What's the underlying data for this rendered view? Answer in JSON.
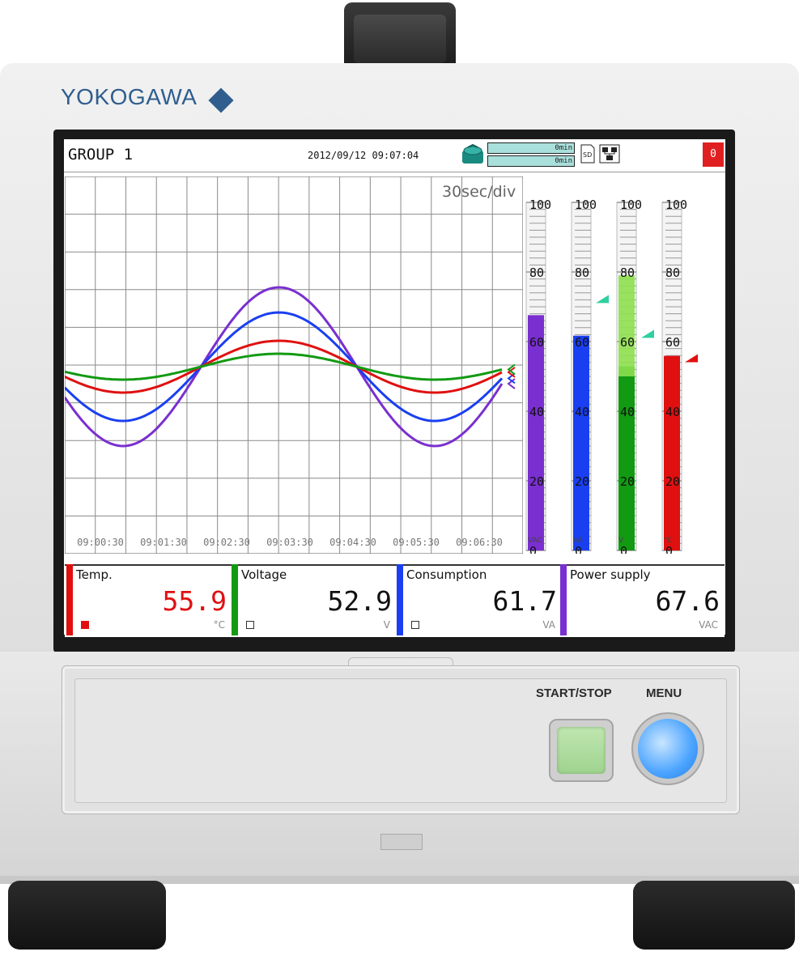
{
  "device": {
    "brand": "YOKOGAWA",
    "buttons": {
      "start_stop_label": "START/STOP",
      "menu_label": "MENU"
    }
  },
  "header": {
    "group_title": "GROUP 1",
    "datetime": "2012/09/12 09:07:04",
    "memory_bar_1": "0min",
    "memory_bar_2": "0min",
    "alarm_indicator": "0"
  },
  "trend": {
    "timebase": "30sec/div",
    "time_labels": [
      "09:00:30",
      "09:01:30",
      "09:02:30",
      "09:03:30",
      "09:04:30",
      "09:05:30",
      "09:06:30"
    ]
  },
  "bargraphs": {
    "scale_labels": [
      "100",
      "80",
      "60",
      "40",
      "20",
      "0"
    ],
    "unit_labels": [
      "VAC",
      "VA",
      "V",
      "°C"
    ]
  },
  "channels": [
    {
      "name": "Temp.",
      "value": "55.9",
      "unit": "°C",
      "color": "#e01010",
      "value_color": "#e01010"
    },
    {
      "name": "Voltage",
      "value": "52.9",
      "unit": "V",
      "color": "#129a12",
      "value_color": "#111111"
    },
    {
      "name": "Consumption",
      "value": "61.7",
      "unit": "VA",
      "color": "#1a3ff0",
      "value_color": "#111111"
    },
    {
      "name": "Power supply",
      "value": "67.6",
      "unit": "VAC",
      "color": "#7a2fd0",
      "value_color": "#111111"
    }
  ],
  "colors": {
    "temp": "#e01010",
    "voltage": "#129a12",
    "consumption": "#1a3ff0",
    "power_supply": "#7a2fd0",
    "voltage_bar_high": "#8ee050",
    "brand": "#2f5e8e"
  }
}
